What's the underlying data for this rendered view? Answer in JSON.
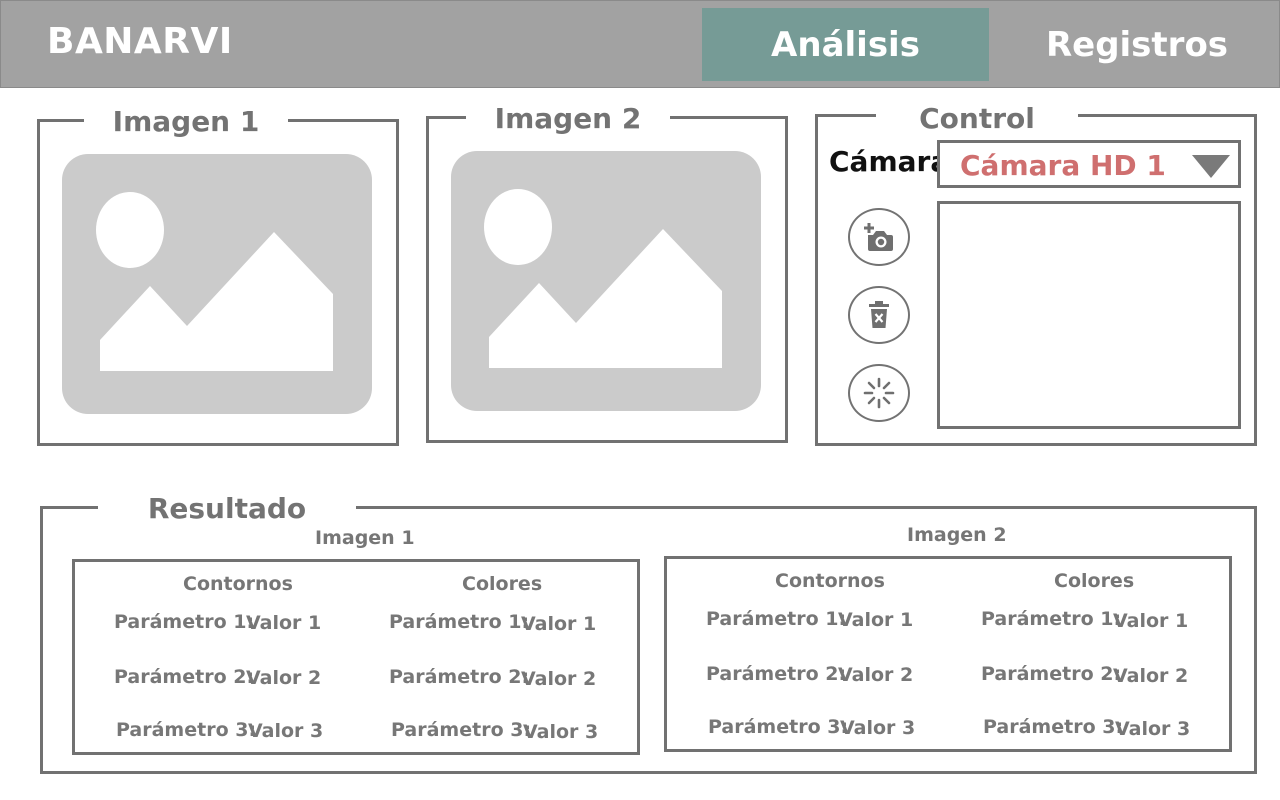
{
  "header": {
    "app_title": "BANARVI",
    "tabs": [
      {
        "label": "Análisis",
        "active": true
      },
      {
        "label": "Registros",
        "active": false
      }
    ],
    "active_tab_color": "#769b96",
    "bar_color": "#a2a2a2"
  },
  "images": {
    "image1": {
      "title": "Imagen 1",
      "icon": "image-placeholder-icon"
    },
    "image2": {
      "title": "Imagen 2",
      "icon": "image-placeholder-icon"
    }
  },
  "control": {
    "title": "Control",
    "camera_label": "Cámara",
    "camera_selected": "Cámara HD 1",
    "selected_color": "#cf6f6f",
    "buttons": [
      {
        "icon": "add-camera-icon"
      },
      {
        "icon": "delete-icon"
      },
      {
        "icon": "loading-spinner-icon"
      }
    ]
  },
  "results": {
    "title": "Resultado",
    "panels": [
      {
        "title": "Imagen 1",
        "columns": [
          {
            "heading": "Contornos",
            "rows": [
              {
                "param": "Parámetro 1:",
                "value": "Valor 1"
              },
              {
                "param": "Parámetro 2:",
                "value": "Valor 2"
              },
              {
                "param": "Parámetro 3:",
                "value": "Valor 3"
              }
            ]
          },
          {
            "heading": "Colores",
            "rows": [
              {
                "param": "Parámetro 1:",
                "value": "Valor 1"
              },
              {
                "param": "Parámetro 2:",
                "value": "Valor 2"
              },
              {
                "param": "Parámetro 3:",
                "value": "Valor 3"
              }
            ]
          }
        ]
      },
      {
        "title": "Imagen 2",
        "columns": [
          {
            "heading": "Contornos",
            "rows": [
              {
                "param": "Parámetro 1:",
                "value": "Valor 1"
              },
              {
                "param": "Parámetro 2:",
                "value": "Valor 2"
              },
              {
                "param": "Parámetro 3:",
                "value": "Valor 3"
              }
            ]
          },
          {
            "heading": "Colores",
            "rows": [
              {
                "param": "Parámetro 1:",
                "value": "Valor 1"
              },
              {
                "param": "Parámetro 2:",
                "value": "Valor 2"
              },
              {
                "param": "Parámetro 3:",
                "value": "Valor 3"
              }
            ]
          }
        ]
      }
    ]
  }
}
